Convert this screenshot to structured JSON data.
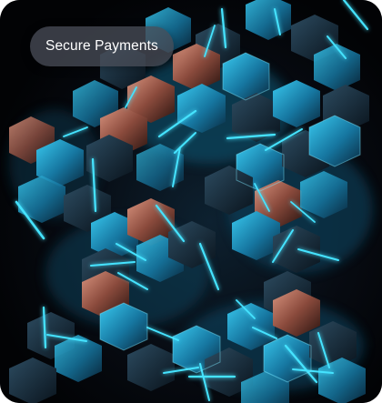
{
  "hero": {
    "badge_label": "Secure Payments",
    "image_subject": "abstract-glowing-hexagonal-crystals",
    "colors": {
      "background": "#05070c",
      "glow": "#29d9ff",
      "cyan_face": "#1a8fb8",
      "copper_face": "#b86a56",
      "badge_bg": "#484c56",
      "badge_text": "#ffffff"
    }
  }
}
